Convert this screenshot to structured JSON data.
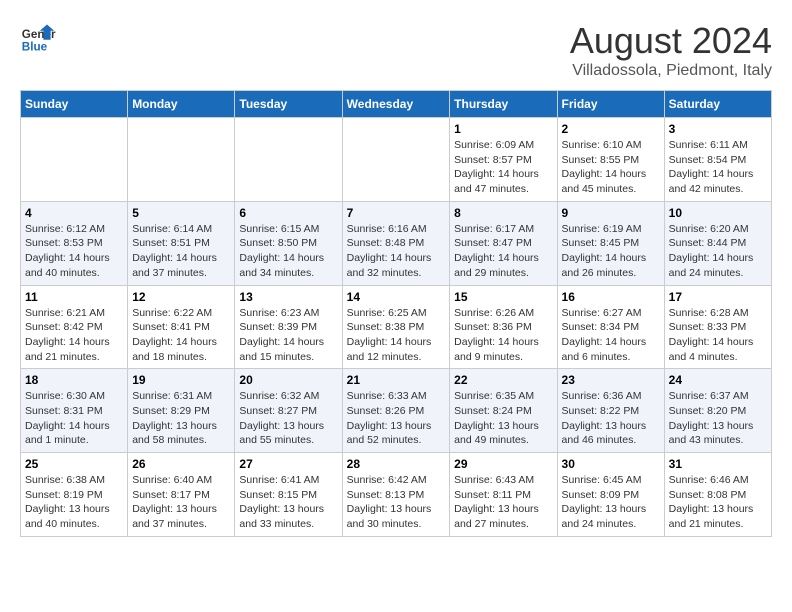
{
  "header": {
    "logo_line1": "General",
    "logo_line2": "Blue",
    "month_title": "August 2024",
    "location": "Villadossola, Piedmont, Italy"
  },
  "days_of_week": [
    "Sunday",
    "Monday",
    "Tuesday",
    "Wednesday",
    "Thursday",
    "Friday",
    "Saturday"
  ],
  "weeks": [
    [
      {
        "num": "",
        "info": ""
      },
      {
        "num": "",
        "info": ""
      },
      {
        "num": "",
        "info": ""
      },
      {
        "num": "",
        "info": ""
      },
      {
        "num": "1",
        "info": "Sunrise: 6:09 AM\nSunset: 8:57 PM\nDaylight: 14 hours and 47 minutes."
      },
      {
        "num": "2",
        "info": "Sunrise: 6:10 AM\nSunset: 8:55 PM\nDaylight: 14 hours and 45 minutes."
      },
      {
        "num": "3",
        "info": "Sunrise: 6:11 AM\nSunset: 8:54 PM\nDaylight: 14 hours and 42 minutes."
      }
    ],
    [
      {
        "num": "4",
        "info": "Sunrise: 6:12 AM\nSunset: 8:53 PM\nDaylight: 14 hours and 40 minutes."
      },
      {
        "num": "5",
        "info": "Sunrise: 6:14 AM\nSunset: 8:51 PM\nDaylight: 14 hours and 37 minutes."
      },
      {
        "num": "6",
        "info": "Sunrise: 6:15 AM\nSunset: 8:50 PM\nDaylight: 14 hours and 34 minutes."
      },
      {
        "num": "7",
        "info": "Sunrise: 6:16 AM\nSunset: 8:48 PM\nDaylight: 14 hours and 32 minutes."
      },
      {
        "num": "8",
        "info": "Sunrise: 6:17 AM\nSunset: 8:47 PM\nDaylight: 14 hours and 29 minutes."
      },
      {
        "num": "9",
        "info": "Sunrise: 6:19 AM\nSunset: 8:45 PM\nDaylight: 14 hours and 26 minutes."
      },
      {
        "num": "10",
        "info": "Sunrise: 6:20 AM\nSunset: 8:44 PM\nDaylight: 14 hours and 24 minutes."
      }
    ],
    [
      {
        "num": "11",
        "info": "Sunrise: 6:21 AM\nSunset: 8:42 PM\nDaylight: 14 hours and 21 minutes."
      },
      {
        "num": "12",
        "info": "Sunrise: 6:22 AM\nSunset: 8:41 PM\nDaylight: 14 hours and 18 minutes."
      },
      {
        "num": "13",
        "info": "Sunrise: 6:23 AM\nSunset: 8:39 PM\nDaylight: 14 hours and 15 minutes."
      },
      {
        "num": "14",
        "info": "Sunrise: 6:25 AM\nSunset: 8:38 PM\nDaylight: 14 hours and 12 minutes."
      },
      {
        "num": "15",
        "info": "Sunrise: 6:26 AM\nSunset: 8:36 PM\nDaylight: 14 hours and 9 minutes."
      },
      {
        "num": "16",
        "info": "Sunrise: 6:27 AM\nSunset: 8:34 PM\nDaylight: 14 hours and 6 minutes."
      },
      {
        "num": "17",
        "info": "Sunrise: 6:28 AM\nSunset: 8:33 PM\nDaylight: 14 hours and 4 minutes."
      }
    ],
    [
      {
        "num": "18",
        "info": "Sunrise: 6:30 AM\nSunset: 8:31 PM\nDaylight: 14 hours and 1 minute."
      },
      {
        "num": "19",
        "info": "Sunrise: 6:31 AM\nSunset: 8:29 PM\nDaylight: 13 hours and 58 minutes."
      },
      {
        "num": "20",
        "info": "Sunrise: 6:32 AM\nSunset: 8:27 PM\nDaylight: 13 hours and 55 minutes."
      },
      {
        "num": "21",
        "info": "Sunrise: 6:33 AM\nSunset: 8:26 PM\nDaylight: 13 hours and 52 minutes."
      },
      {
        "num": "22",
        "info": "Sunrise: 6:35 AM\nSunset: 8:24 PM\nDaylight: 13 hours and 49 minutes."
      },
      {
        "num": "23",
        "info": "Sunrise: 6:36 AM\nSunset: 8:22 PM\nDaylight: 13 hours and 46 minutes."
      },
      {
        "num": "24",
        "info": "Sunrise: 6:37 AM\nSunset: 8:20 PM\nDaylight: 13 hours and 43 minutes."
      }
    ],
    [
      {
        "num": "25",
        "info": "Sunrise: 6:38 AM\nSunset: 8:19 PM\nDaylight: 13 hours and 40 minutes."
      },
      {
        "num": "26",
        "info": "Sunrise: 6:40 AM\nSunset: 8:17 PM\nDaylight: 13 hours and 37 minutes."
      },
      {
        "num": "27",
        "info": "Sunrise: 6:41 AM\nSunset: 8:15 PM\nDaylight: 13 hours and 33 minutes."
      },
      {
        "num": "28",
        "info": "Sunrise: 6:42 AM\nSunset: 8:13 PM\nDaylight: 13 hours and 30 minutes."
      },
      {
        "num": "29",
        "info": "Sunrise: 6:43 AM\nSunset: 8:11 PM\nDaylight: 13 hours and 27 minutes."
      },
      {
        "num": "30",
        "info": "Sunrise: 6:45 AM\nSunset: 8:09 PM\nDaylight: 13 hours and 24 minutes."
      },
      {
        "num": "31",
        "info": "Sunrise: 6:46 AM\nSunset: 8:08 PM\nDaylight: 13 hours and 21 minutes."
      }
    ]
  ]
}
